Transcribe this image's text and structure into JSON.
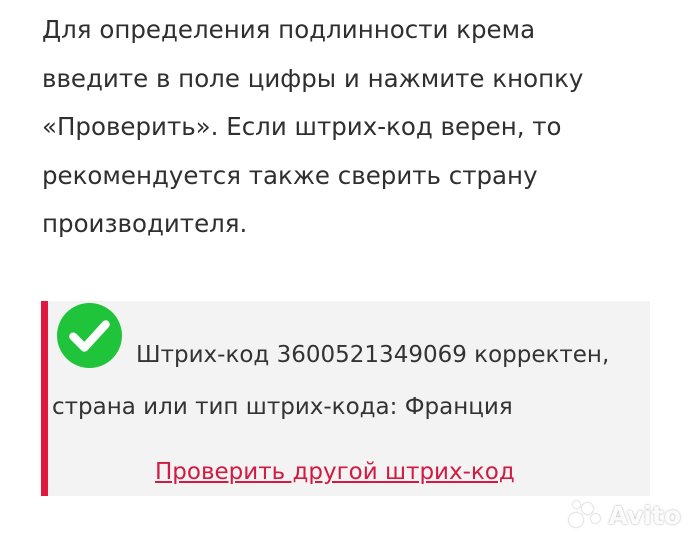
{
  "intro": {
    "lines": [
      "Для определения подлинности крема",
      "введите в поле цифры и нажмите кнопку",
      "«Проверить». Если штрих-код верен, то",
      "рекомендуется также сверить страну",
      "производителя."
    ]
  },
  "result": {
    "status_icon": "checkmark-circle-icon",
    "line1": "Штрих-код 3600521349069 корректен,",
    "line2": "страна или тип штрих-кода: Франция",
    "link_label": "Проверить другой штрих-код"
  },
  "watermark": {
    "label": "Avito"
  },
  "colors": {
    "accent_red": "#e0173f",
    "link_red": "#d21a42",
    "success_green": "#1fc43a",
    "box_background": "#f3f3f3"
  }
}
